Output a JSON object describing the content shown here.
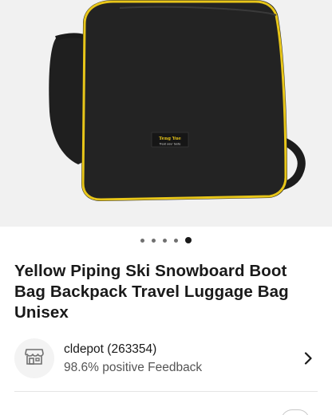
{
  "product": {
    "image_label_brand": "Teng Yue",
    "image_label_tagline": "Treat your taste",
    "carousel": {
      "count": 5,
      "active_index": 4
    },
    "title": "Yellow Piping Ski Snowboard Boot Bag Backpack Travel Luggage Bag Unisex"
  },
  "seller": {
    "icon": "store-icon",
    "name_line": "cldepot (263354)",
    "feedback_line": "98.6% positive Feedback",
    "chevron_icon": "chevron-right-icon"
  },
  "colors": {
    "bag_body": "#222222",
    "piping": "#e8c619",
    "background": "#f1f1f1"
  }
}
